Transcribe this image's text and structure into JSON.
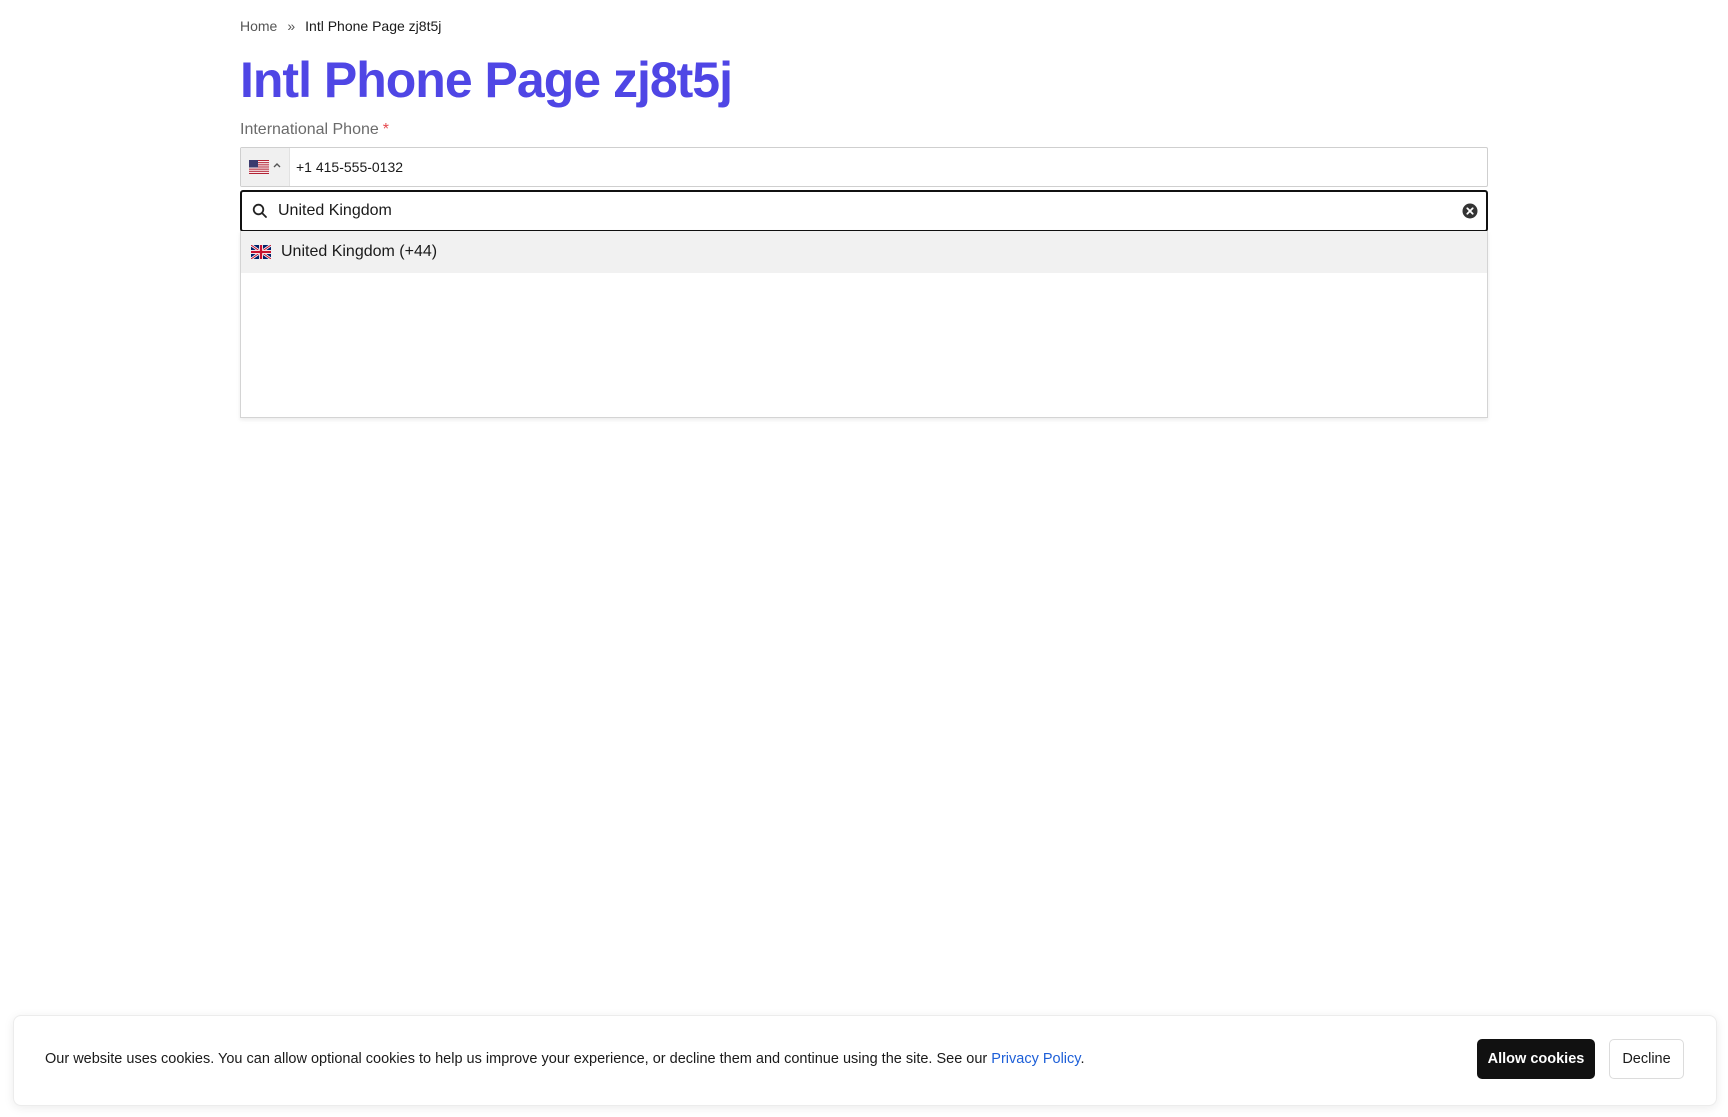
{
  "breadcrumb": {
    "home": "Home",
    "separator": "»",
    "current": "Intl Phone Page zj8t5j"
  },
  "page": {
    "title": "Intl Phone Page zj8t5j"
  },
  "phone_field": {
    "label": "International Phone",
    "required_mark": "*",
    "selected_country_flag": "us-flag-icon",
    "value": "+1 415-555-0132"
  },
  "country_search": {
    "value": "United Kingdom"
  },
  "country_options": [
    {
      "flag": "uk-flag-icon",
      "label": "United Kingdom (+44)"
    }
  ],
  "cookie_banner": {
    "text": "Our website uses cookies. You can allow optional cookies to help us improve your experience, or decline them and continue using the site. See our ",
    "link_text": "Privacy Policy",
    "trailing": ".",
    "allow_label": "Allow cookies",
    "decline_label": "Decline"
  },
  "colors": {
    "title": "#4f46e5",
    "required": "#e5484d",
    "link": "#1d5fd8",
    "allow_button_bg": "#111111"
  }
}
